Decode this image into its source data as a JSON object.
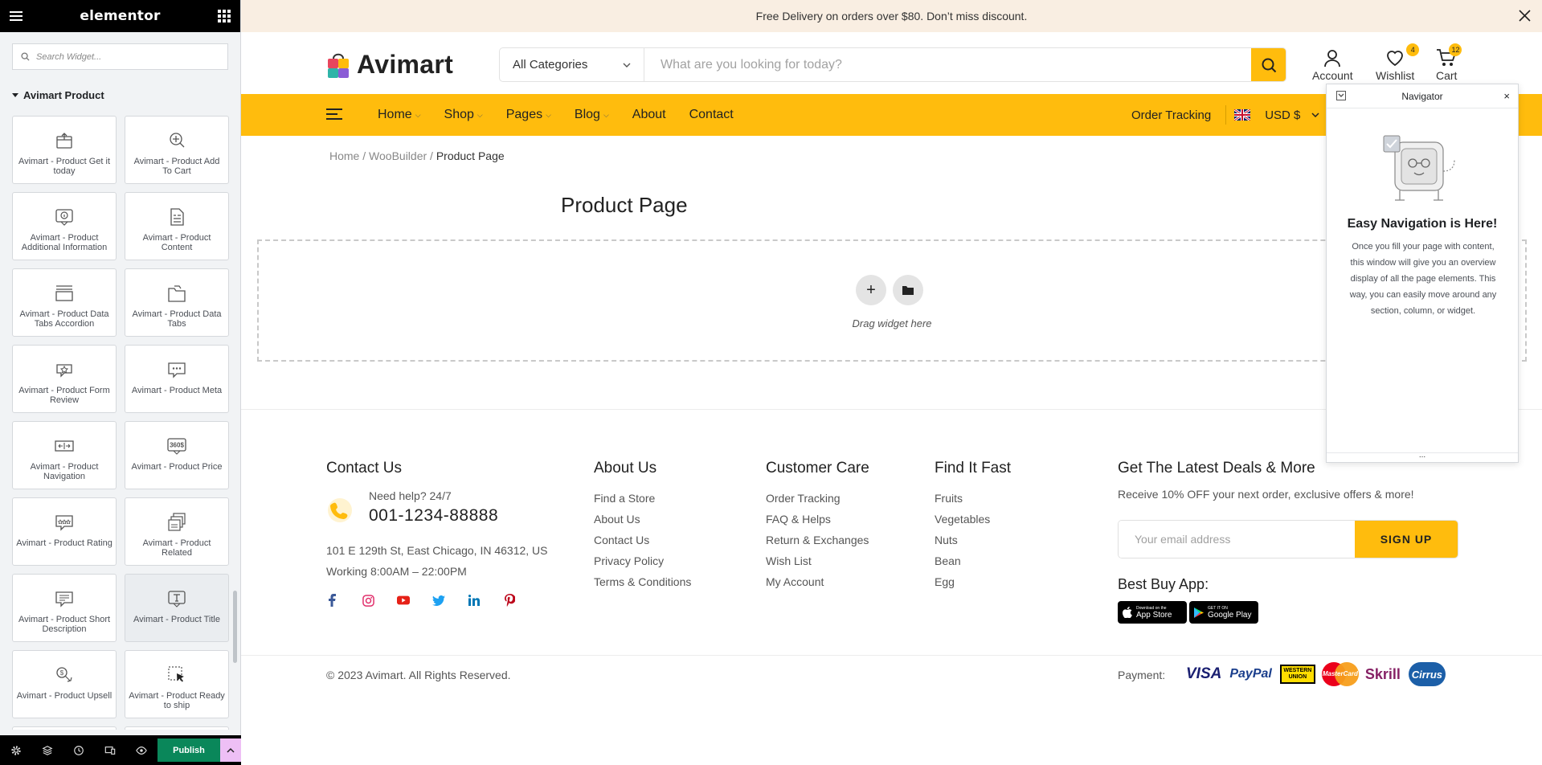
{
  "elementor": {
    "logo": "elementor",
    "search_placeholder": "Search Widget...",
    "category": "Avimart Product",
    "widgets": [
      {
        "label": "Avimart - Product Get it today",
        "icon": "box-icon"
      },
      {
        "label": "Avimart - Product Add To Cart",
        "icon": "add-to-cart-icon"
      },
      {
        "label": "Avimart - Product Additional Information",
        "icon": "info-icon"
      },
      {
        "label": "Avimart - Product Content",
        "icon": "content-icon"
      },
      {
        "label": "Avimart - Product Data Tabs Accordion",
        "icon": "accordion-icon"
      },
      {
        "label": "Avimart - Product Data Tabs",
        "icon": "tabs-icon"
      },
      {
        "label": "Avimart - Product Form Review",
        "icon": "review-icon"
      },
      {
        "label": "Avimart - Product Meta",
        "icon": "meta-icon"
      },
      {
        "label": "Avimart - Product Navigation",
        "icon": "navigation-icon"
      },
      {
        "label": "Avimart - Product Price",
        "icon": "price-icon"
      },
      {
        "label": "Avimart - Product Rating",
        "icon": "rating-icon"
      },
      {
        "label": "Avimart - Product Related",
        "icon": "related-icon"
      },
      {
        "label": "Avimart - Product Short Description",
        "icon": "short-description-icon"
      },
      {
        "label": "Avimart - Product Title",
        "icon": "title-icon"
      },
      {
        "label": "Avimart - Product Upsell",
        "icon": "upsell-icon"
      },
      {
        "label": "Avimart - Product Ready to ship",
        "icon": "ready-to-ship-icon"
      }
    ],
    "publish_label": "Publish"
  },
  "site": {
    "topbar_text": "Free Delivery on orders over $80. Don’t miss discount.",
    "brand": "Avimart",
    "search_category": "All Categories",
    "search_placeholder": "What are you looking for today?",
    "account_label": "Account",
    "wishlist_label": "Wishlist",
    "wishlist_count": "4",
    "cart_label": "Cart",
    "cart_count": "12",
    "nav": [
      {
        "label": "Home",
        "dropdown": true
      },
      {
        "label": "Shop",
        "dropdown": true
      },
      {
        "label": "Pages",
        "dropdown": true
      },
      {
        "label": "Blog",
        "dropdown": true
      },
      {
        "label": "About",
        "dropdown": false
      },
      {
        "label": "Contact",
        "dropdown": false
      }
    ],
    "order_tracking": "Order Tracking",
    "currency": "USD $",
    "breadcrumb": {
      "home": "Home",
      "sep": " / ",
      "parent": "WooBuilder",
      "current": "Product Page"
    },
    "page_title": "Product Page",
    "drop_text": "Drag widget here"
  },
  "footer": {
    "contact": {
      "heading": "Contact Us",
      "help": "Need help? 24/7",
      "phone": "001-1234-88888",
      "address": "101 E 129th St, East Chicago, IN 46312, US",
      "hours": "Working 8:00AM – 22:00PM"
    },
    "columns": [
      {
        "heading": "About Us",
        "links": [
          "Find a Store",
          "About Us",
          "Contact Us",
          "Privacy Policy",
          "Terms & Conditions"
        ]
      },
      {
        "heading": "Customer Care",
        "links": [
          "Order Tracking",
          "FAQ & Helps",
          "Return & Exchanges",
          "Wish List",
          "My Account"
        ]
      },
      {
        "heading": "Find It Fast",
        "links": [
          "Fruits",
          "Vegetables",
          "Nuts",
          "Bean",
          "Egg"
        ]
      }
    ],
    "deals": {
      "heading": "Get The Latest Deals & More",
      "sub": "Receive 10% OFF your next order, exclusive offers & more!",
      "email_placeholder": "Your email address",
      "signup": "SIGN UP",
      "app_heading": "Best Buy App:",
      "appstore_small": "Download on the",
      "appstore": "App Store",
      "googleplay_small": "GET IT ON",
      "googleplay": "Google Play"
    },
    "copyright": "© 2023 Avimart. All Rights Reserved.",
    "payment_label": "Payment:",
    "payment_methods": [
      "VISA",
      "PayPal",
      "WESTERN UNION",
      "MasterCard",
      "Skrill",
      "Cirrus"
    ]
  },
  "navigator": {
    "title": "Navigator",
    "heading": "Easy Navigation is Here!",
    "description": "Once you fill your page with content, this window will give you an overview display of all the page elements. This way, you can easily move around any section, column, or widget.",
    "footer_dots": "..."
  },
  "colors": {
    "accent": "#ffbc0d",
    "publish": "#0a875a",
    "topbar": "#f9eee2"
  }
}
